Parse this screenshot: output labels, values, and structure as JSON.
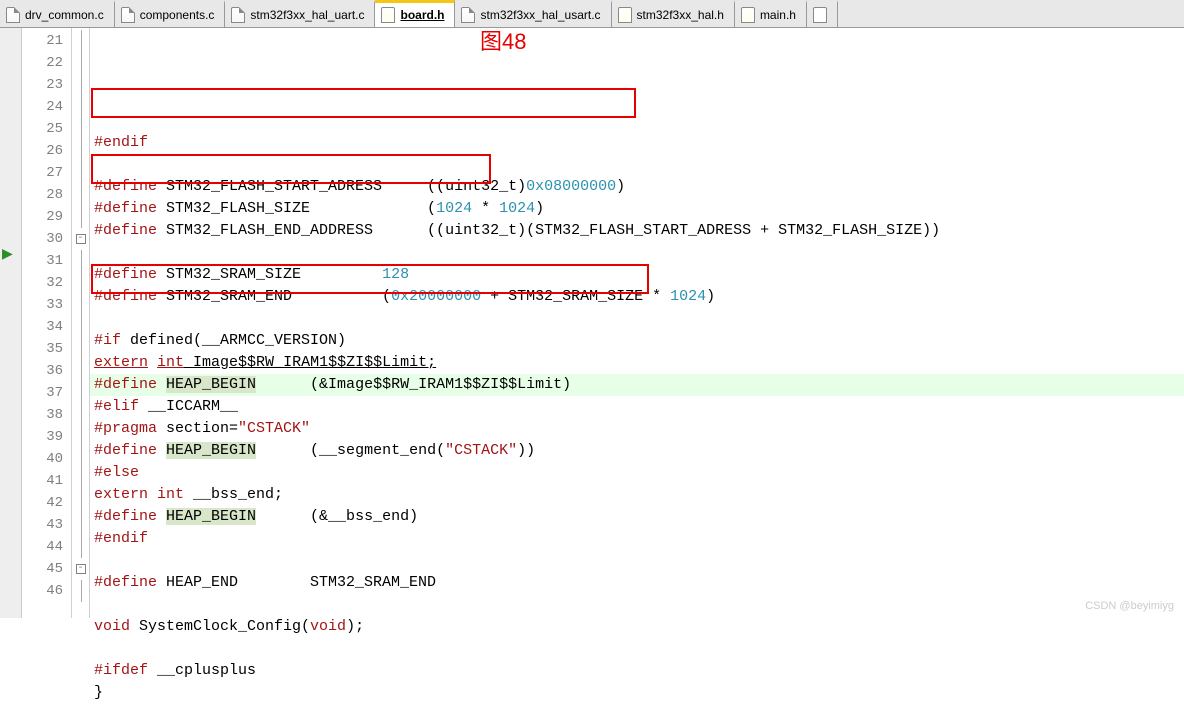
{
  "tabs": [
    {
      "label": "drv_common.c",
      "type": "c",
      "active": false
    },
    {
      "label": "components.c",
      "type": "c",
      "active": false
    },
    {
      "label": "stm32f3xx_hal_uart.c",
      "type": "c",
      "active": false
    },
    {
      "label": "board.h",
      "type": "h",
      "active": true
    },
    {
      "label": "stm32f3xx_hal_usart.c",
      "type": "c",
      "active": false
    },
    {
      "label": "stm32f3xx_hal.h",
      "type": "hr",
      "active": false
    },
    {
      "label": "main.h",
      "type": "h",
      "active": false
    }
  ],
  "annotation": "图48",
  "lines": [
    {
      "n": 21,
      "t": "endif",
      "fold": "line"
    },
    {
      "n": 22,
      "t": "blank",
      "fold": "line"
    },
    {
      "n": 23,
      "t": "def",
      "name": "STM32_FLASH_START_ADRESS",
      "val": "((uint32_t)",
      "num": "0x08000000",
      "tail": ")",
      "fold": "line"
    },
    {
      "n": 24,
      "t": "def",
      "name": "STM32_FLASH_SIZE",
      "val": "(",
      "num": "1024",
      "mid": " * ",
      "num2": "1024",
      "tail": ")",
      "fold": "line"
    },
    {
      "n": 25,
      "t": "def",
      "name": "STM32_FLASH_END_ADDRESS",
      "val": "((uint32_t)(STM32_FLASH_START_ADRESS + STM32_FLASH_SIZE))",
      "fold": "line"
    },
    {
      "n": 26,
      "t": "blank",
      "fold": "line"
    },
    {
      "n": 27,
      "t": "def",
      "name": "STM32_SRAM_SIZE",
      "valnum": "128",
      "fold": "line"
    },
    {
      "n": 28,
      "t": "def",
      "name": "STM32_SRAM_END",
      "val": "(",
      "num": "0x20000000",
      "mid": " + STM32_SRAM_SIZE * ",
      "num2": "1024",
      "tail": ")",
      "fold": "line"
    },
    {
      "n": 29,
      "t": "blank",
      "fold": "line"
    },
    {
      "n": 30,
      "t": "ifdef",
      "txt": "#if defined(__ARMCC_VERSION)",
      "fold": "box"
    },
    {
      "n": 31,
      "t": "extern",
      "txt": "extern int Image$$RW_IRAM1$$ZI$$Limit;",
      "fold": "line",
      "ul": true
    },
    {
      "n": 32,
      "t": "defhl",
      "name": "HEAP_BEGIN",
      "val": "(&Image$$RW_IRAM1$$ZI$$Limit)",
      "fold": "line",
      "hl": true
    },
    {
      "n": 33,
      "t": "elif",
      "txt": "#elif __ICCARM__",
      "fold": "line"
    },
    {
      "n": 34,
      "t": "pragma",
      "txt": "#pragma section=\"CSTACK\"",
      "fold": "line"
    },
    {
      "n": 35,
      "t": "def",
      "name": "HEAP_BEGIN",
      "val": "(__segment_end(\"CSTACK\"))",
      "fold": "line",
      "sel": true
    },
    {
      "n": 36,
      "t": "else",
      "txt": "#else",
      "fold": "line"
    },
    {
      "n": 37,
      "t": "extern2",
      "txt": "extern int __bss_end;",
      "fold": "line"
    },
    {
      "n": 38,
      "t": "def",
      "name": "HEAP_BEGIN",
      "val": "(&__bss_end)",
      "fold": "line",
      "sel": true
    },
    {
      "n": 39,
      "t": "endif",
      "fold": "line"
    },
    {
      "n": 40,
      "t": "blank",
      "fold": "line"
    },
    {
      "n": 41,
      "t": "def",
      "name": "HEAP_END",
      "val": "STM32_SRAM_END",
      "fold": "line"
    },
    {
      "n": 42,
      "t": "blank",
      "fold": "line"
    },
    {
      "n": 43,
      "t": "proto",
      "txt": "void SystemClock_Config(void);",
      "fold": "line"
    },
    {
      "n": 44,
      "t": "blank",
      "fold": "line"
    },
    {
      "n": 45,
      "t": "ifdef2",
      "txt": "#ifdef __cplusplus",
      "fold": "box"
    },
    {
      "n": 46,
      "t": "brace",
      "txt": "}",
      "fold": "line"
    }
  ],
  "watermark": "CSDN @beyimiyg"
}
